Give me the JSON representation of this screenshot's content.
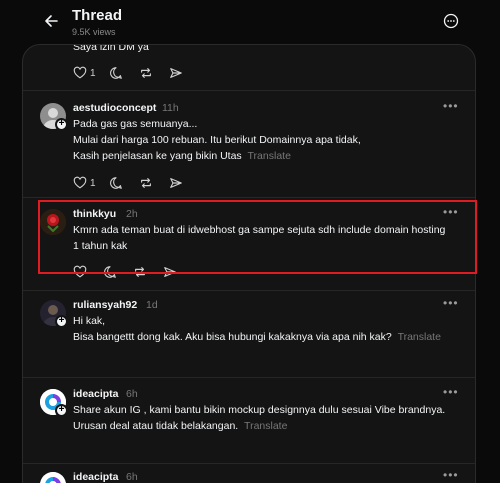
{
  "header": {
    "title": "Thread",
    "views": "9.5K views"
  },
  "posts": [
    {
      "username": "",
      "time": "",
      "lines": [
        "Saya izin DM ya"
      ],
      "translate": "",
      "like_count": "1"
    },
    {
      "username": "aestudioconcept",
      "time": "11h",
      "lines": [
        "Pada gas gas semuanya...",
        "Mulai dari harga 100 rebuan. Itu berikut Domainnya apa tidak,",
        "Kasih penjelasan ke yang bikin Utas"
      ],
      "translate": "Translate",
      "like_count": "1"
    },
    {
      "username": "thinkkyu",
      "time": "2h",
      "lines": [
        "Kmrn ada teman buat di idwebhost ga sampe sejuta sdh include domain hosting",
        "1 tahun kak"
      ],
      "translate": "",
      "like_count": ""
    },
    {
      "username": "ruliansyah92",
      "time": "1d",
      "lines": [
        "Hi kak,",
        "Bisa bangettt dong kak. Aku bisa hubungi kakaknya via apa nih kak?"
      ],
      "translate": "Translate",
      "like_count": ""
    },
    {
      "username": "ideacipta",
      "time": "6h",
      "lines": [
        "Share akun IG , kami bantu bikin mockup designnya dulu sesuai Vibe brandnya.",
        "Urusan deal atau tidak belakangan."
      ],
      "translate": "Translate",
      "like_count": ""
    },
    {
      "username": "ideacipta",
      "time": "6h",
      "lines": [],
      "translate": "",
      "like_count": ""
    }
  ],
  "colors": {
    "background": "#0a0a0a",
    "panel": "#141414",
    "highlight": "#e11b22",
    "muted": "#777777"
  },
  "icons": [
    "back-arrow-icon",
    "more-circle-icon",
    "heart-icon",
    "comment-icon",
    "repost-icon",
    "share-icon",
    "plus-icon"
  ]
}
